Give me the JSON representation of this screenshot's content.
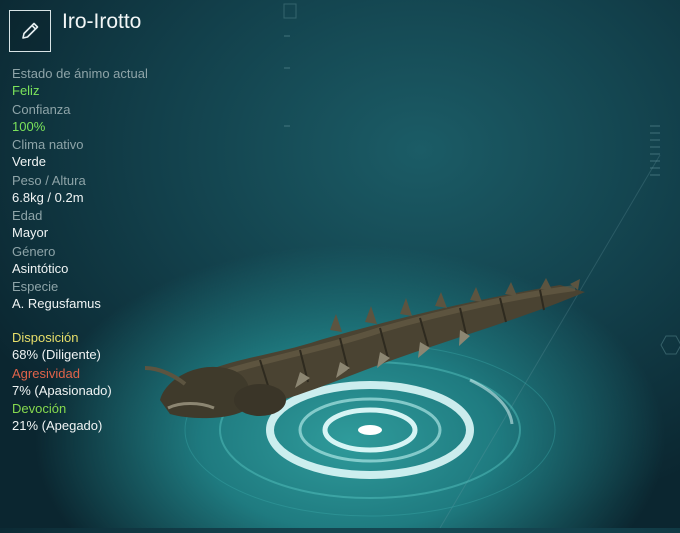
{
  "header": {
    "title": "Iro-Irotto",
    "edit_icon": "pencil-icon"
  },
  "stats": [
    {
      "label": "Estado de ánimo actual",
      "value": "Feliz",
      "color": "#7be35b"
    },
    {
      "label": "Confianza",
      "value": "100%",
      "color": "#7be35b"
    },
    {
      "label": "Clima nativo",
      "value": "Verde"
    },
    {
      "label": "Peso / Altura",
      "value": "6.8kg / 0.2m"
    },
    {
      "label": "Edad",
      "value": "Mayor"
    },
    {
      "label": "Género",
      "value": "Asintótico"
    },
    {
      "label": "Especie",
      "value": "A. Regusfamus"
    }
  ],
  "traits": [
    {
      "label": "Disposición",
      "value": "68% (Diligente)",
      "color": "#e8df6a"
    },
    {
      "label": "Agresividad",
      "value": "7% (Apasionado)",
      "color": "#e0634a"
    },
    {
      "label": "Devoción",
      "value": "21% (Apegado)",
      "color": "#86d94e"
    }
  ]
}
